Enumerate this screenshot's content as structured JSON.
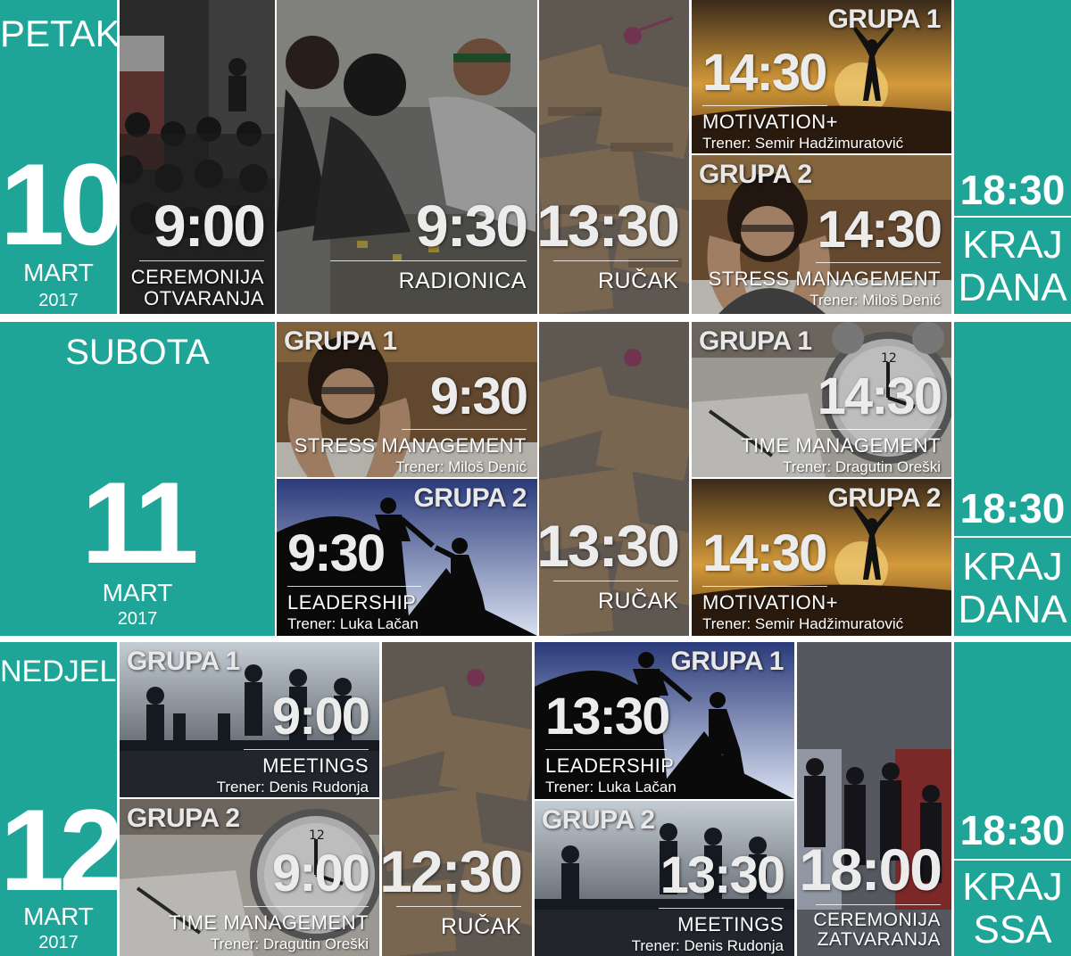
{
  "days": [
    {
      "name": "PETAK",
      "number": "10",
      "month": "MART",
      "year": "2017",
      "end": {
        "time": "18:30",
        "line1": "KRAJ",
        "line2": "DANA"
      },
      "sessions": [
        {
          "time": "9:00",
          "line1": "CEREMONIJA",
          "line2": "OTVARANJA"
        },
        {
          "time": "9:30",
          "title": "RADIONICA"
        },
        {
          "time": "13:30",
          "title": "RUČAK"
        },
        {
          "group": "GRUPA 1",
          "time": "14:30",
          "title": "MOTIVATION+",
          "trainer": "Trener: Semir Hadžimuratović"
        },
        {
          "group": "GRUPA 2",
          "time": "14:30",
          "title": "STRESS MANAGEMENT",
          "trainer": "Trener: Miloš Denić"
        }
      ]
    },
    {
      "name": "SUBOTA",
      "number": "11",
      "month": "MART",
      "year": "2017",
      "end": {
        "time": "18:30",
        "line1": "KRAJ",
        "line2": "DANA"
      },
      "sessions": [
        {
          "group": "GRUPA 1",
          "time": "9:30",
          "title": "STRESS MANAGEMENT",
          "trainer": "Trener: Miloš Denić"
        },
        {
          "group": "GRUPA 2",
          "time": "9:30",
          "title": "LEADERSHIP",
          "trainer": "Trener: Luka Lačan"
        },
        {
          "time": "13:30",
          "title": "RUČAK"
        },
        {
          "group": "GRUPA 1",
          "time": "14:30",
          "title": "TIME MANAGEMENT",
          "trainer": "Trener: Dragutin Oreški"
        },
        {
          "group": "GRUPA 2",
          "time": "14:30",
          "title": "MOTIVATION+",
          "trainer": "Trener: Semir Hadžimuratović"
        }
      ]
    },
    {
      "name": "NEDJELJA",
      "number": "12",
      "month": "MART",
      "year": "2017",
      "end": {
        "time": "18:30",
        "line1": "KRAJ",
        "line2": "SSA"
      },
      "sessions": [
        {
          "group": "GRUPA 1",
          "time": "9:00",
          "title": "MEETINGS",
          "trainer": "Trener: Denis Rudonja"
        },
        {
          "group": "GRUPA 2",
          "time": "9:00",
          "title": "TIME MANAGEMENT",
          "trainer": "Trener: Dragutin Oreški"
        },
        {
          "time": "12:30",
          "title": "RUČAK"
        },
        {
          "group": "GRUPA 1",
          "time": "13:30",
          "title": "LEADERSHIP",
          "trainer": "Trener: Luka Lačan"
        },
        {
          "group": "GRUPA 2",
          "time": "13:30",
          "title": "MEETINGS",
          "trainer": "Trener: Denis Rudonja"
        },
        {
          "time": "18:00",
          "line1": "CEREMONIJA",
          "line2": "ZATVARANJA"
        }
      ]
    }
  ],
  "colors": {
    "teal": "#1fa598"
  }
}
